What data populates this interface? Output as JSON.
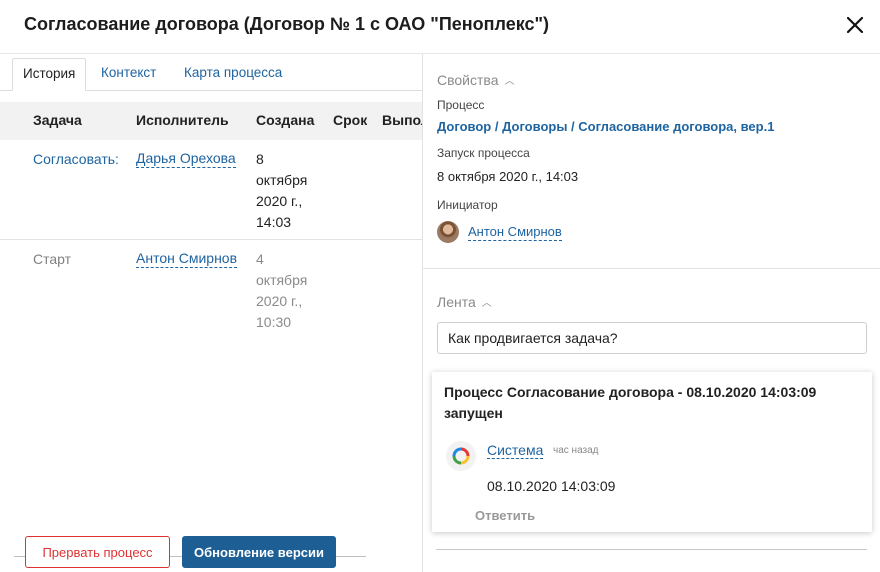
{
  "window": {
    "title": "Согласование договора (Договор № 1 с ОАО \"Пеноплекс\")",
    "close_icon": "close-icon"
  },
  "tabs": [
    {
      "label": "История",
      "active": true
    },
    {
      "label": "Контекст",
      "active": false
    },
    {
      "label": "Карта процесса",
      "active": false
    }
  ],
  "table": {
    "columns": [
      "Задача",
      "Исполнитель",
      "Создана",
      "Срок",
      "Выпол"
    ],
    "rows": [
      {
        "task": "Согласовать:",
        "assignee": "Дарья Орехова",
        "created": "8 октября 2020 г., 14:03"
      },
      {
        "task": "Старт",
        "assignee": "Антон Смирнов",
        "created": "4 октября 2020 г., 10:30"
      }
    ]
  },
  "actions": {
    "stop": "Прервать процесс",
    "update": "Обновление версии"
  },
  "properties": {
    "title": "Свойства",
    "process_label": "Процесс",
    "process_value": "Договор / Договоры / Согласование договора, вер.1",
    "start_label": "Запуск процесса",
    "start_value": "8 октября 2020 г., 14:03",
    "initiator_label": "Инициатор",
    "initiator_name": "Антон Смирнов"
  },
  "feed": {
    "title": "Лента",
    "input_value": "Как продвигается задача?",
    "card": {
      "title": "Процесс Согласование договора - 08.10.2020 14:03:09 запущен",
      "author": "Система",
      "time": "час назад",
      "text": "08.10.2020 14:03:09",
      "reply": "Ответить"
    }
  },
  "colors": {
    "link": "#1e64a0",
    "primary_button": "#1d5f95",
    "danger": "#dd3333"
  }
}
